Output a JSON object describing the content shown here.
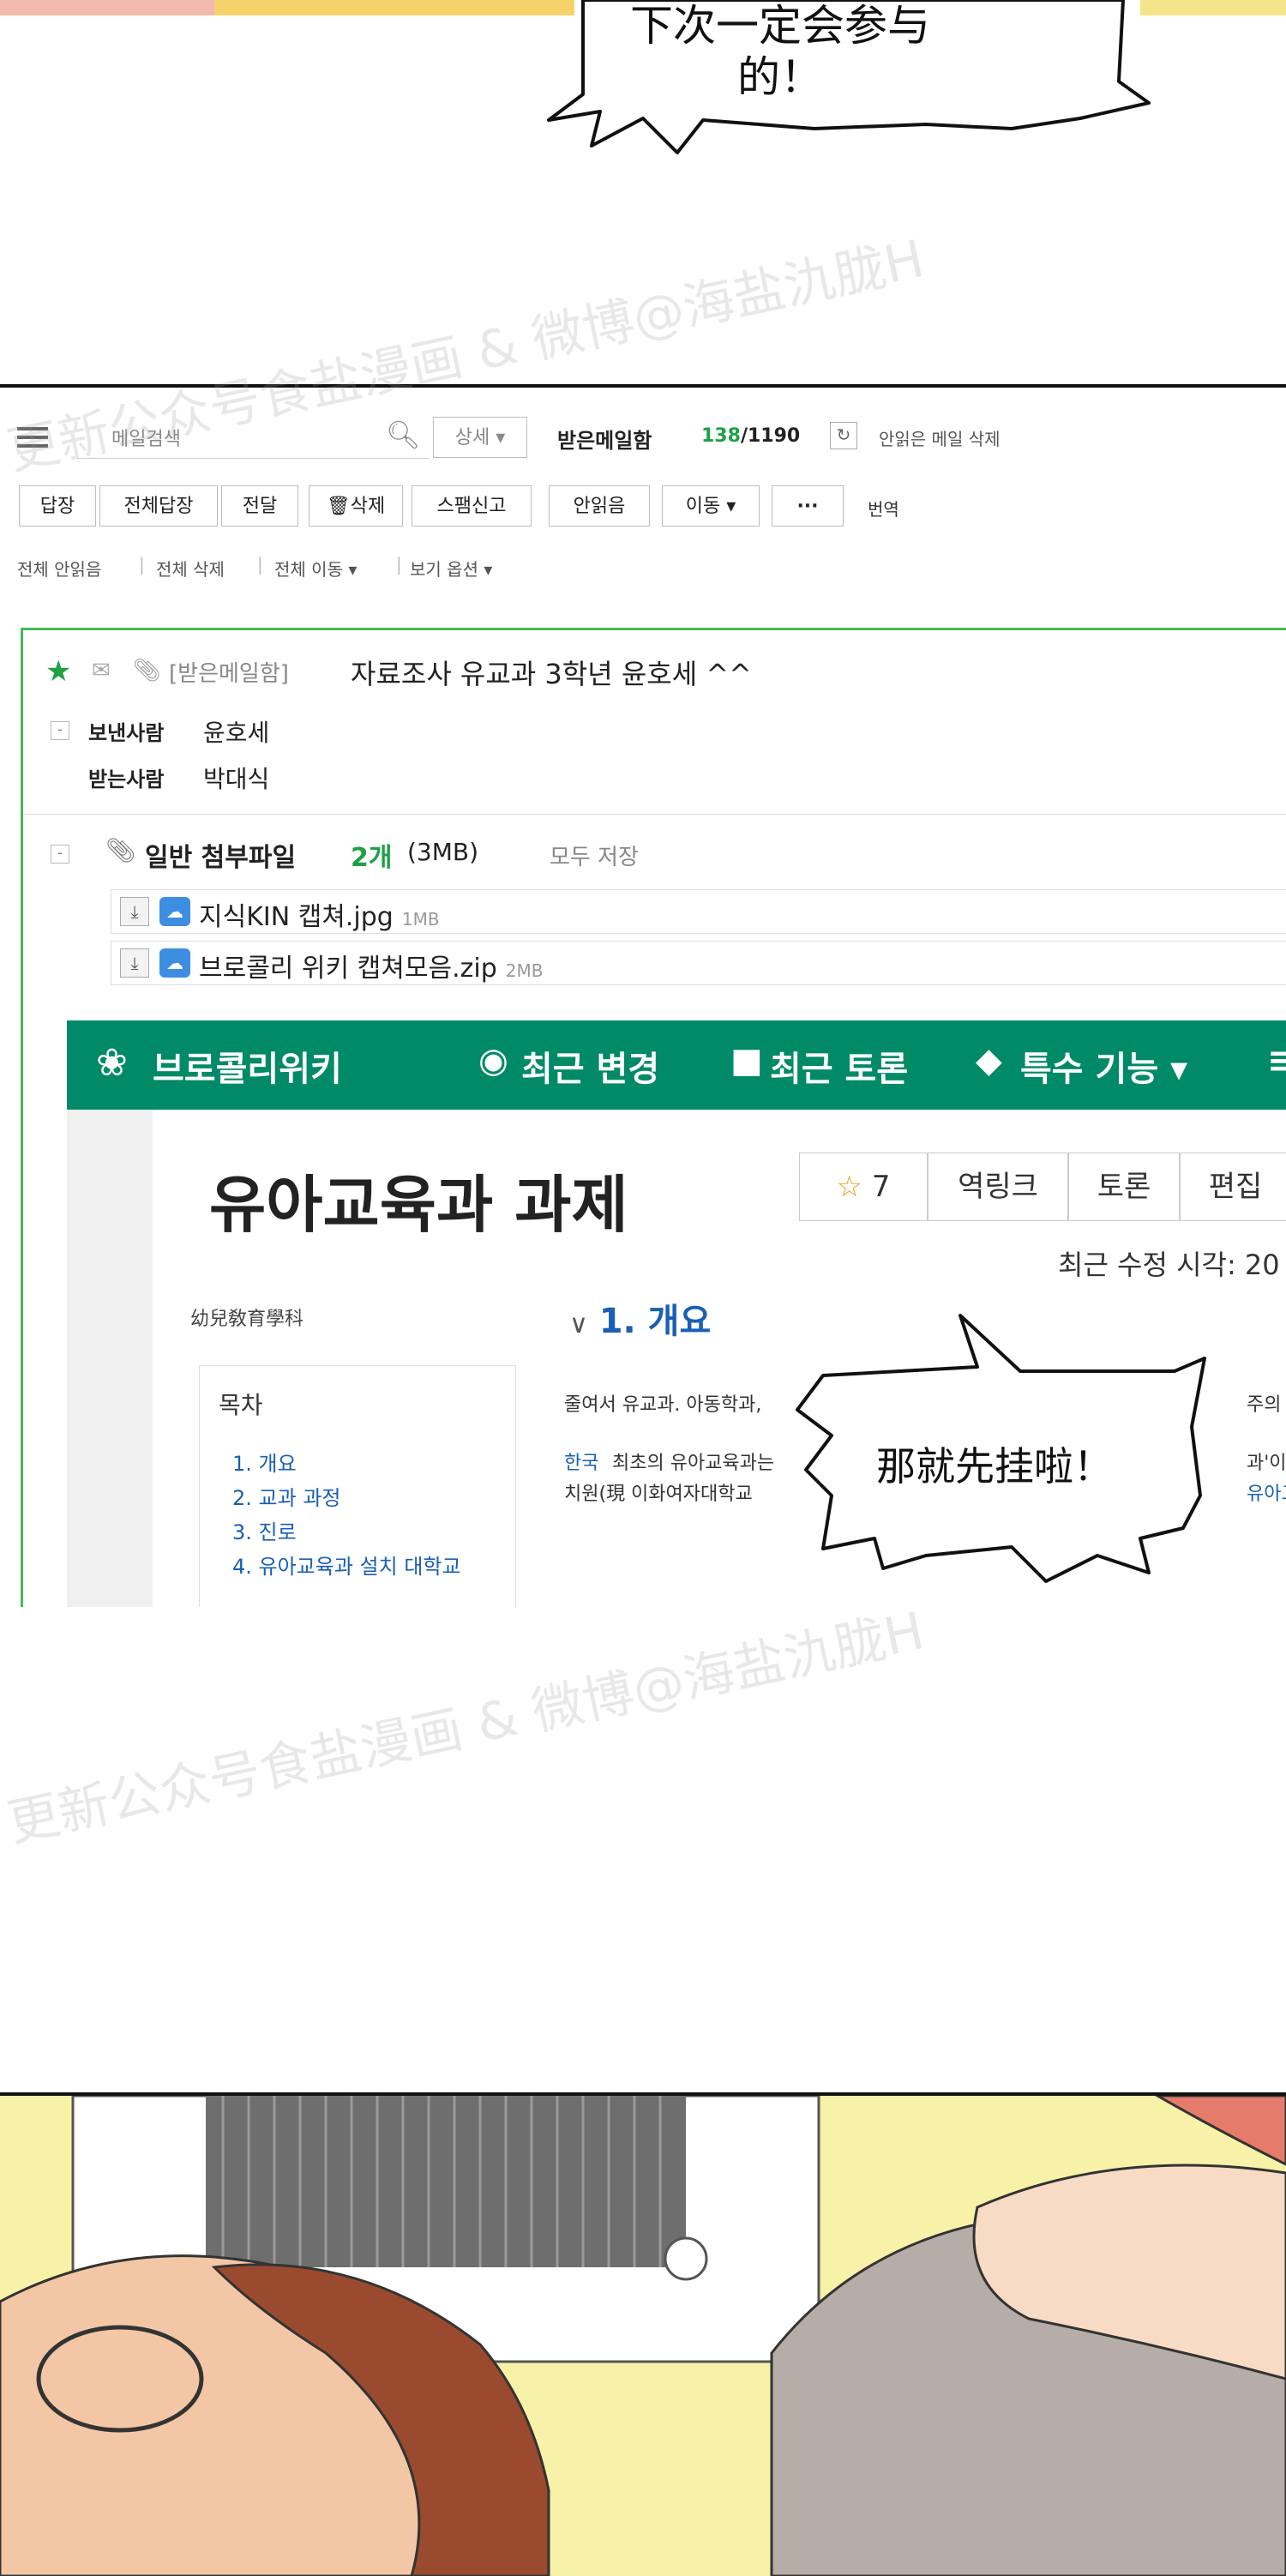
{
  "top_bubble": {
    "text": "下次一定会参与的！"
  },
  "mail": {
    "search_placeholder": "메일검색",
    "detail_label": "상세 ▾",
    "folder_label": "받은메일함",
    "unread_count": "138",
    "total_count": "/1190",
    "delete_unread_label": "안읽은 메일 삭제",
    "buttons": [
      "답장",
      "전체답장",
      "전달",
      "삭제",
      "스팸신고",
      "안읽음",
      "이동 ▾",
      "···"
    ],
    "translate_label": "번역",
    "sub_actions": [
      "전체 안읽음",
      "전체 삭제",
      "전체 이동 ▾",
      "보기 옵션 ▾"
    ],
    "folder_tag": "[받은메일함]",
    "subject": "자료조사 유교과 3학년 윤호세 ^^",
    "sender_label": "보낸사람",
    "sender": "윤호세",
    "recipient_label": "받는사람",
    "recipient": "박대식",
    "attach_label": "일반 첨부파일",
    "attach_count": "2개",
    "attach_size": "(3MB)",
    "save_all": "모두 저장",
    "files": [
      {
        "name": "지식KIN 캡쳐.jpg",
        "size": "1MB"
      },
      {
        "name": "브로콜리 위키 캡쳐모음.zip",
        "size": "2MB"
      }
    ]
  },
  "wiki": {
    "brand": "브로콜리위키",
    "nav": [
      "최근 변경",
      "최근 토론",
      "특수 기능 ▾"
    ],
    "title": "유아교육과 과제",
    "star_count": "7",
    "buttons": [
      "역링크",
      "토론",
      "편집"
    ],
    "modified_label": "최근 수정 시각: 20",
    "hanja": "幼兒敎育學科",
    "section_heading": "1. 개요",
    "toc_title": "목차",
    "toc_items": [
      "1. 개요",
      "2. 교과 과정",
      "3. 진로",
      "4. 유아교육과 설치 대학교"
    ],
    "para_lines": [
      "줄여서 유교과. 아동학과,",
      "주의 요망.",
      "한국",
      "최초의 유아교육과는",
      "과'이다(現",
      "치원(現 이화여자대학교",
      "유아교사를"
    ]
  },
  "bottom_bubble": {
    "text": "那就先挂啦！"
  },
  "watermark": "更新公众号食盐漫画 & 微博@海盐氿胧H"
}
